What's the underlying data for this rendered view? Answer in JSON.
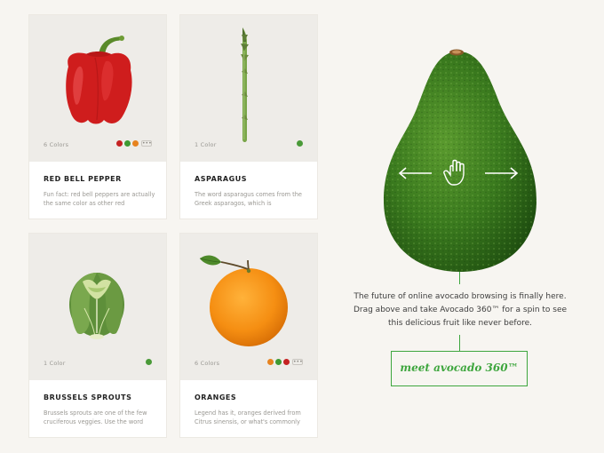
{
  "cards": [
    {
      "title": "RED BELL PEPPER",
      "colors_count": "6 Colors",
      "description": "Fun fact: red bell peppers are actually the same color as other red",
      "swatches": [
        "#c52222",
        "#3f9a33",
        "#e7831f"
      ],
      "has_more": true,
      "more_label": "•••"
    },
    {
      "title": "ASPARAGUS",
      "colors_count": "1 Color",
      "description": "The word asparagus comes from the Greek asparagos, which is",
      "swatches": [
        "#4a9a38"
      ],
      "has_more": false,
      "more_label": ""
    },
    {
      "title": "BRUSSELS SPROUTS",
      "colors_count": "1 Color",
      "description": "Brussels sprouts are one of the few cruciferous veggies. Use the word",
      "swatches": [
        "#4a9a38"
      ],
      "has_more": false,
      "more_label": ""
    },
    {
      "title": "ORANGES",
      "colors_count": "6 Colors",
      "description": "Legend has it, oranges derived from Citrus sinensis, or what's commonly",
      "swatches": [
        "#e7831f",
        "#3f9a33",
        "#c52222"
      ],
      "has_more": true,
      "more_label": "•••"
    }
  ],
  "hero": {
    "tagline_line1": "The future of online avocado browsing is finally here.",
    "tagline_line2": "Drag above and take Avocado 360™ for a spin to see",
    "tagline_line3": "this delicious fruit like never before.",
    "cta_label": "meet avocado 360™"
  },
  "colors": {
    "accent": "#3ea63e",
    "background": "#f7f5f1",
    "card_image_bg": "#eeece8"
  }
}
